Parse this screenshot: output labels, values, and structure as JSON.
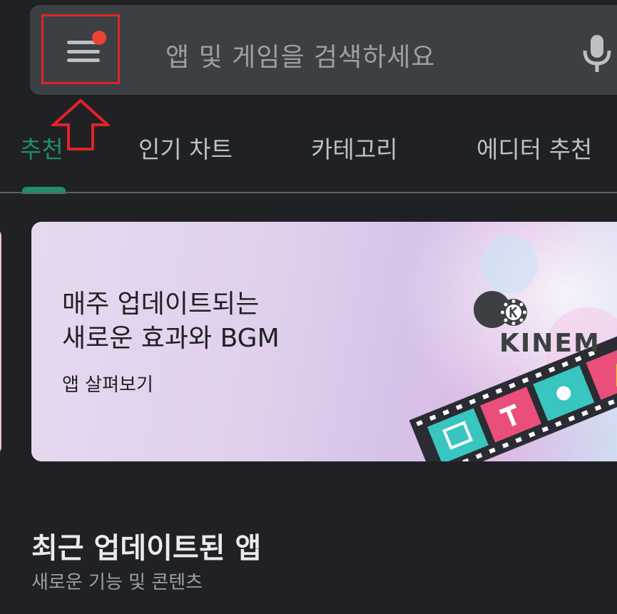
{
  "search": {
    "placeholder": "앱 및 게임을 검색하세요"
  },
  "tabs": [
    {
      "label": "추천",
      "active": true
    },
    {
      "label": "인기 차트",
      "active": false
    },
    {
      "label": "카테고리",
      "active": false
    },
    {
      "label": "에디터 추천",
      "active": false
    }
  ],
  "banner": {
    "title_line1": "매주 업데이트되는",
    "title_line2": "새로운 효과와 BGM",
    "link": "앱 살펴보기",
    "brand": "KINEM"
  },
  "section": {
    "title": "최근 업데이트된 앱",
    "subtitle": "새로운 기능 및 콘텐츠"
  },
  "colors": {
    "accent": "#1e8e6e",
    "annotation": "#e02424",
    "notification": "#ea4335"
  },
  "icons": [
    "menu-icon",
    "notification-dot-icon",
    "mic-icon",
    "up-arrow-annotation-icon"
  ]
}
